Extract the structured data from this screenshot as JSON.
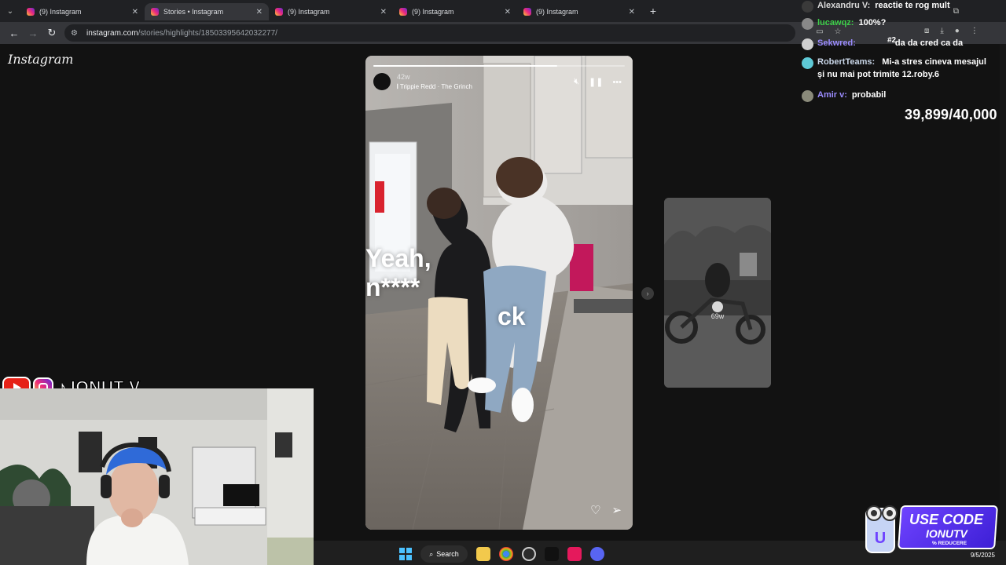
{
  "browser": {
    "tabs": [
      {
        "title": "(9) Instagram",
        "active": false
      },
      {
        "title": "Stories • Instagram",
        "active": true
      },
      {
        "title": "(9) Instagram",
        "active": false
      },
      {
        "title": "(9) Instagram",
        "active": false
      },
      {
        "title": "(9) Instagram",
        "active": false
      }
    ],
    "url_host": "instagram.com",
    "url_path": "/stories/highlights/18503395642032277/"
  },
  "instagram": {
    "logo": "Instagram",
    "story": {
      "age": "42w",
      "music": "Trippie Redd · The Grinch",
      "caption_lines": [
        "Yeah,",
        "n****",
        "ck"
      ],
      "progress_fraction": 0.73
    },
    "next_story": {
      "age": "69w"
    }
  },
  "chat": {
    "messages": [
      {
        "user": "Alexandru V:",
        "text": "reactie te rog mult",
        "user_color": "#d9d9d9"
      },
      {
        "user": "lucawqz:",
        "text": "100%?",
        "user_color": "#3ecf4a"
      },
      {
        "user": "Sekwred:",
        "text": "da da cred ca da",
        "user_color": "#9b8cff"
      },
      {
        "user": "RobertTeams:",
        "text": "Mi-a stres cineva mesajul și nu mai pot trimite 12.roby.6",
        "user_color": "#c9d6e8"
      },
      {
        "user": "Amir v:",
        "text": "probabil",
        "user_color": "#9b8cff"
      }
    ],
    "badge": "#2"
  },
  "counter": {
    "current": "39,899",
    "goal": "40,000"
  },
  "social": {
    "name": "IONUT V"
  },
  "promo": {
    "title": "USE CODE",
    "code": "IONUTV",
    "sub": "% REDUCERE"
  },
  "taskbar": {
    "search_label": "Search",
    "date": "9/5/2025"
  }
}
